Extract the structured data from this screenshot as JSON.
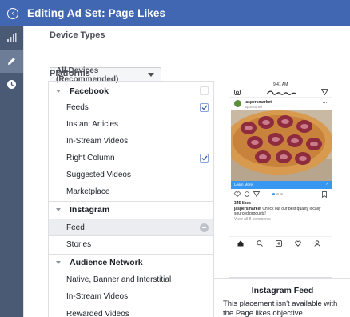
{
  "header": {
    "title": "Editing Ad Set: Page Likes",
    "back_icon": "chevron-circle-left-icon"
  },
  "rail": {
    "items": [
      {
        "icon": "bar-chart-icon",
        "active": false
      },
      {
        "icon": "pencil-icon",
        "active": true
      },
      {
        "icon": "clock-icon",
        "active": false
      }
    ]
  },
  "device_types": {
    "label": "Device Types",
    "value": "All Devices (Recommended)"
  },
  "platforms": {
    "label": "Platforms",
    "groups": [
      {
        "name": "Facebook",
        "items": [
          {
            "label": "Feeds",
            "checked": true
          },
          {
            "label": "Instant Articles",
            "checked": false
          },
          {
            "label": "In-Stream Videos",
            "checked": false
          },
          {
            "label": "Right Column",
            "checked": true
          },
          {
            "label": "Suggested Videos",
            "checked": false
          },
          {
            "label": "Marketplace",
            "checked": false
          }
        ]
      },
      {
        "name": "Instagram",
        "items": [
          {
            "label": "Feed",
            "unavailable": true
          },
          {
            "label": "Stories"
          }
        ]
      },
      {
        "name": "Audience Network",
        "items": [
          {
            "label": "Native, Banner and Interstitial"
          },
          {
            "label": "In-Stream Videos"
          },
          {
            "label": "Rewarded Videos"
          }
        ]
      }
    ]
  },
  "preview": {
    "status_time": "9:41 AM",
    "account": "jaspersmarket",
    "sponsored": "Sponsored",
    "cta": "Learn More",
    "likes": "345 likes",
    "caption_user": "jaspersmarket",
    "caption_text": "Check out our best quality locally sourced products!",
    "view_comments": "View all 8 comments",
    "title": "Instagram Feed",
    "message": "This placement isn't available with the Page likes objective.",
    "colors": {
      "cta": "#3897f0",
      "brand": "#4267b2"
    }
  }
}
